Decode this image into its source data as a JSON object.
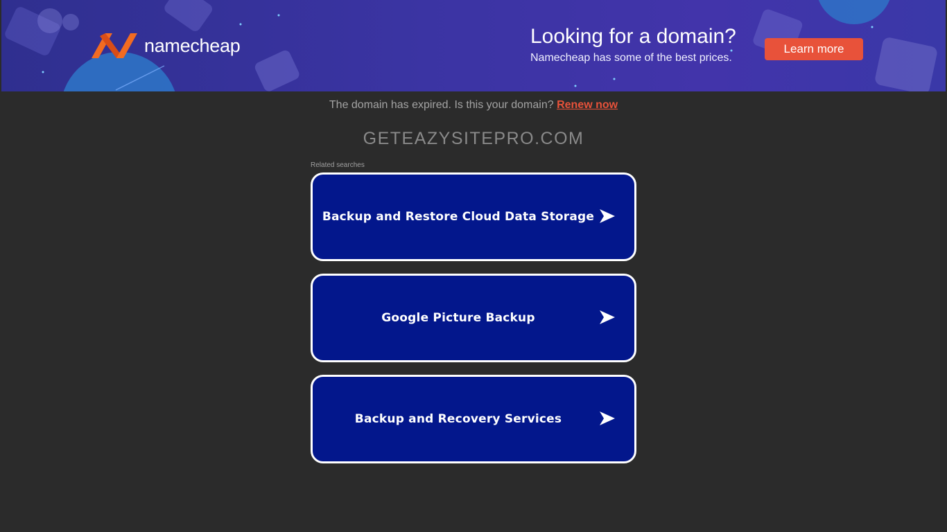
{
  "banner": {
    "logo_text": "namecheap",
    "promo_title": "Looking for a domain?",
    "promo_subtitle": "Namecheap has some of the best prices.",
    "cta_label": "Learn more",
    "colors": {
      "background": "#3b34a3",
      "accent": "#e8523a",
      "logo_orange": "#f26b21"
    }
  },
  "notice": {
    "text": "The domain has expired. Is this your domain?",
    "link_label": "Renew now"
  },
  "domain_name": "GETEAZYSITEPRO.COM",
  "related": {
    "label": "Related searches",
    "items": [
      {
        "label": "Backup and Restore Cloud Data Storage",
        "icon": "arrow-right-icon"
      },
      {
        "label": "Google Picture Backup",
        "icon": "arrow-right-icon"
      },
      {
        "label": "Backup and Recovery Services",
        "icon": "arrow-right-icon"
      }
    ]
  }
}
